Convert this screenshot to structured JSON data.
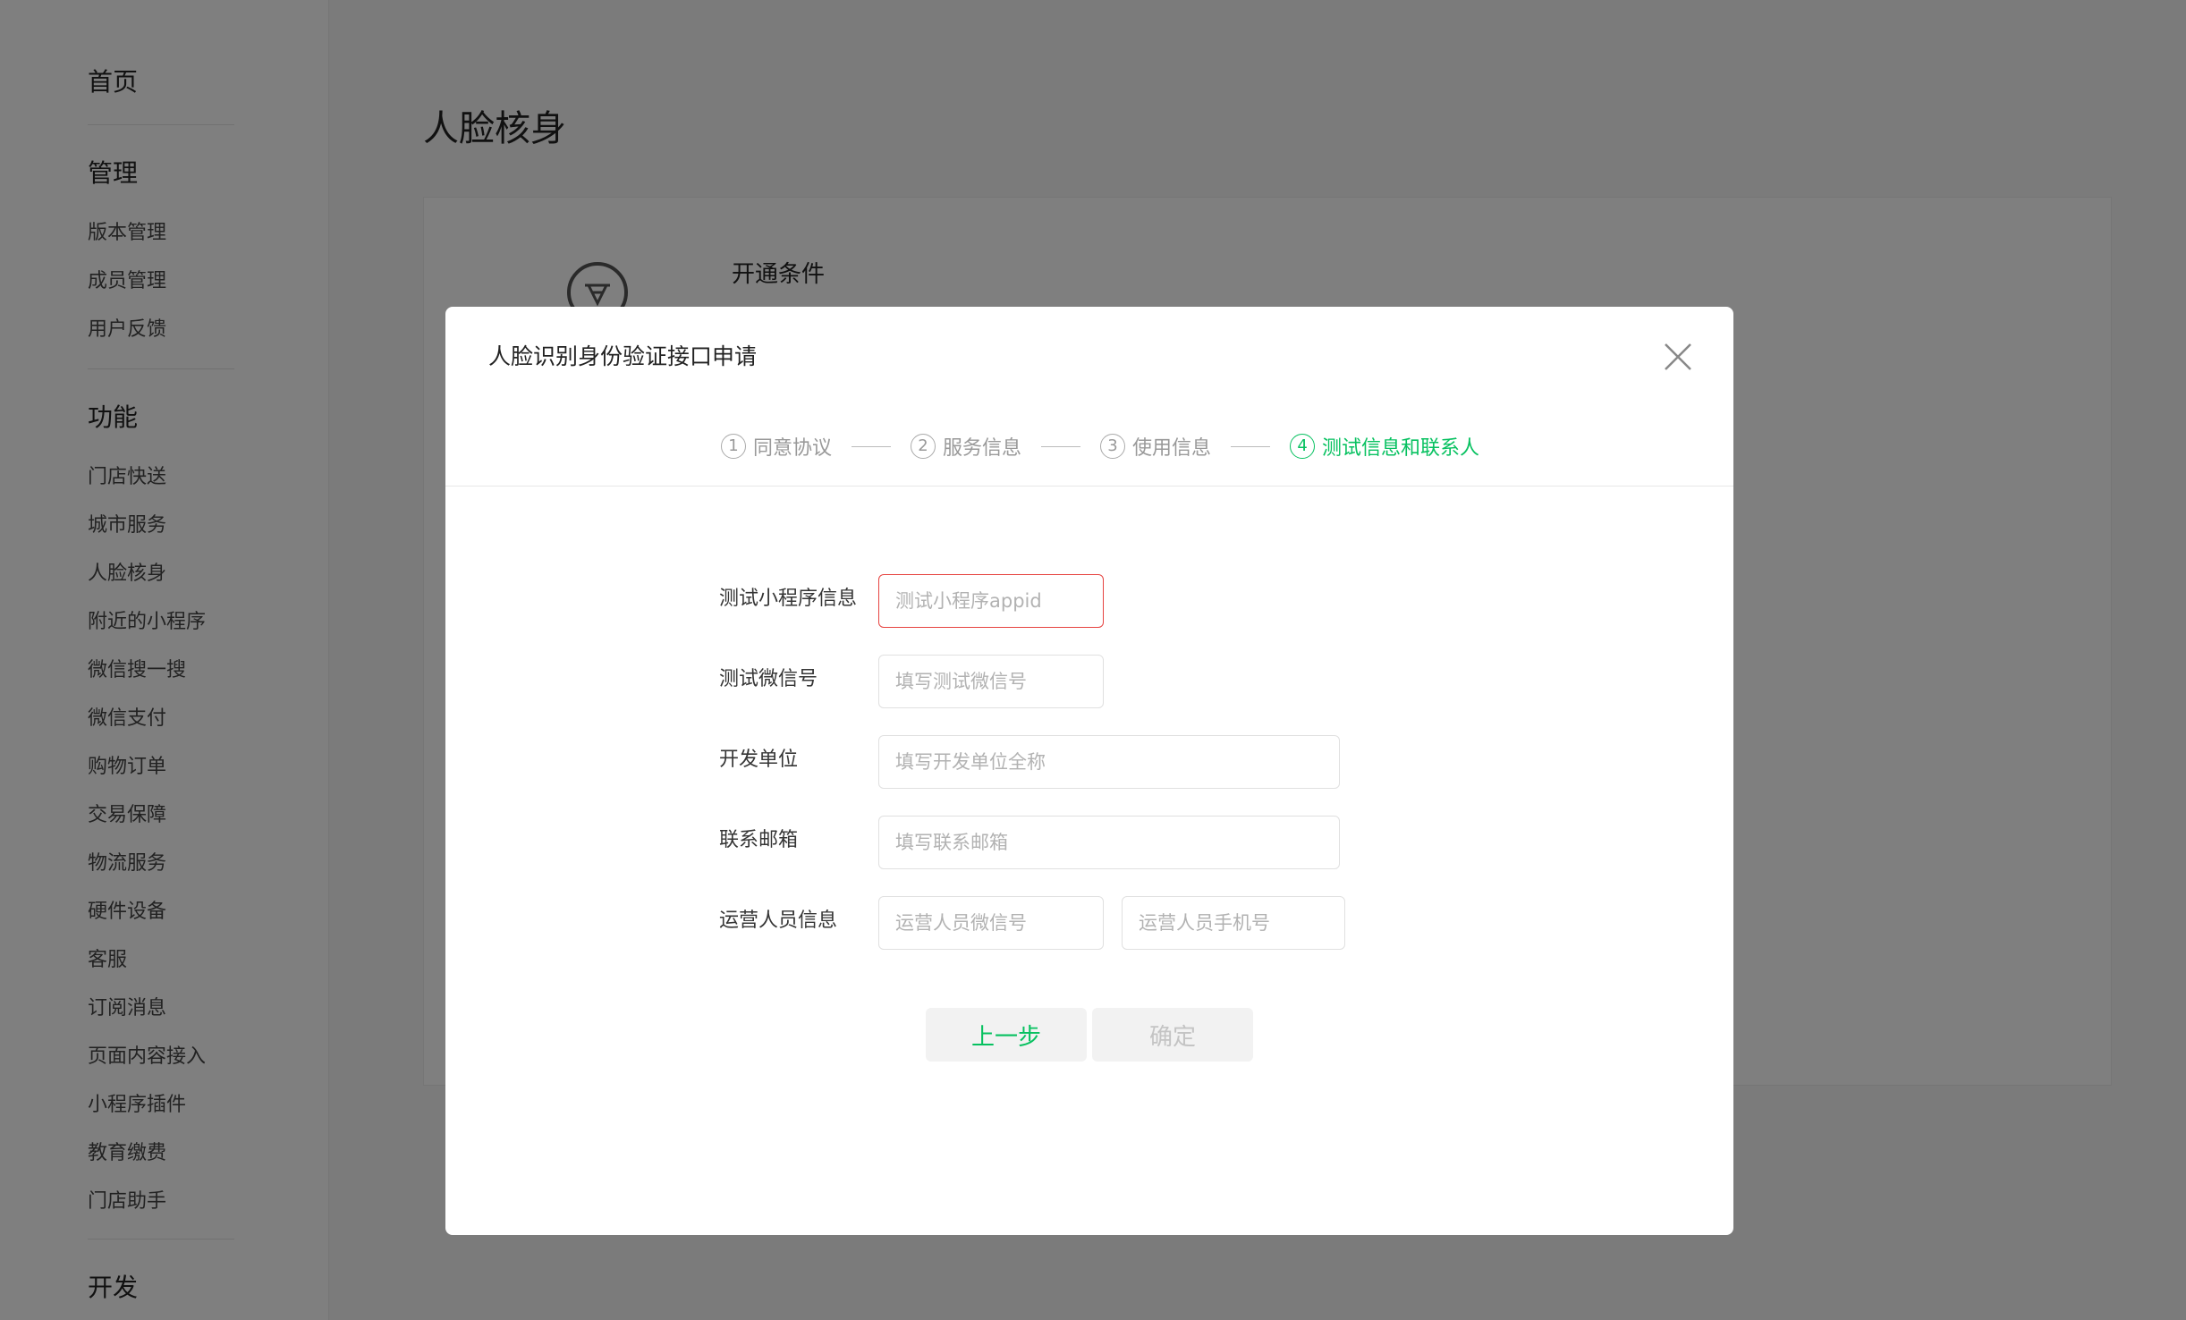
{
  "sidebar": {
    "home": "首页",
    "manage": {
      "title": "管理",
      "items": [
        "版本管理",
        "成员管理",
        "用户反馈"
      ]
    },
    "features": {
      "title": "功能",
      "items": [
        "门店快送",
        "城市服务",
        "人脸核身",
        "附近的小程序",
        "微信搜一搜",
        "微信支付",
        "购物订单",
        "交易保障",
        "物流服务",
        "硬件设备",
        "客服",
        "订阅消息",
        "页面内容接入",
        "小程序插件",
        "教育缴费",
        "门店助手"
      ]
    },
    "dev": {
      "title": "开发"
    }
  },
  "main": {
    "title": "人脸核身",
    "card": {
      "heading": "开通条件",
      "icon": "face-verify-icon"
    }
  },
  "dialog": {
    "title": "人脸识别身份验证接口申请",
    "close_icon": "close-icon",
    "steps": [
      {
        "num": "1",
        "label": "同意协议",
        "active": false
      },
      {
        "num": "2",
        "label": "服务信息",
        "active": false
      },
      {
        "num": "3",
        "label": "使用信息",
        "active": false
      },
      {
        "num": "4",
        "label": "测试信息和联系人",
        "active": true
      }
    ],
    "form": {
      "test_app": {
        "label": "测试小程序信息",
        "placeholder": "测试小程序appid",
        "value": ""
      },
      "test_wechat": {
        "label": "测试微信号",
        "placeholder": "填写测试微信号",
        "value": ""
      },
      "dev_company": {
        "label": "开发单位",
        "placeholder": "填写开发单位全称",
        "value": ""
      },
      "email": {
        "label": "联系邮箱",
        "placeholder": "填写联系邮箱",
        "value": ""
      },
      "operator": {
        "label": "运营人员信息",
        "wechat_placeholder": "运营人员微信号",
        "phone_placeholder": "运营人员手机号"
      }
    },
    "buttons": {
      "prev": "上一步",
      "confirm": "确定"
    }
  },
  "colors": {
    "accent": "#07c160",
    "error": "#e64340",
    "overlay": "rgba(0,0,0,0.5)"
  }
}
